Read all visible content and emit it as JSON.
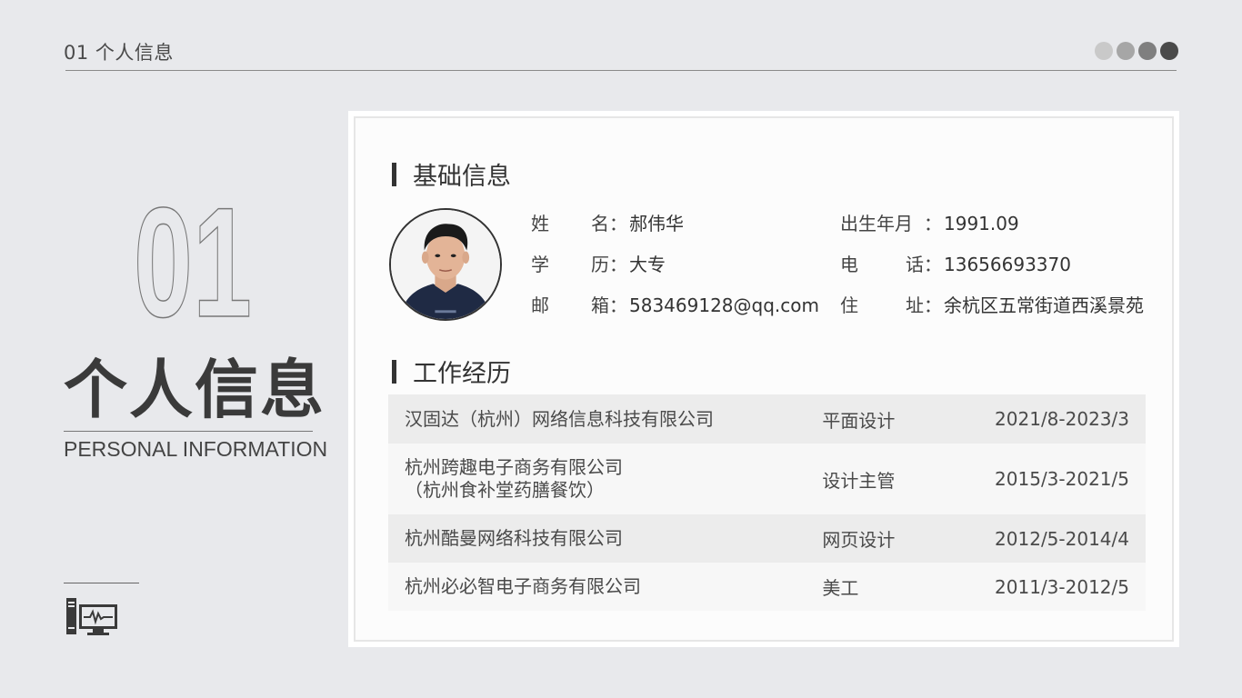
{
  "header": {
    "title": "01 个人信息",
    "dots": [
      "#c9c9c9",
      "#a6a6a6",
      "#7f7f7f",
      "#4a4a4a"
    ]
  },
  "left": {
    "number": "01",
    "title": "个人信息",
    "subtitle": "PERSONAL INFORMATION",
    "icon": "monitor-icon"
  },
  "basic": {
    "heading": "基础信息",
    "fields": [
      {
        "label": "姓名",
        "value": "郝伟华"
      },
      {
        "label": "出生年月",
        "value": "1991.09"
      },
      {
        "label": "学历",
        "value": "大专"
      },
      {
        "label": "电话",
        "value": "13656693370"
      },
      {
        "label": "邮箱",
        "value": "583469128@qq.com"
      },
      {
        "label": "住址",
        "value": "余杭区五常街道西溪景苑"
      }
    ]
  },
  "work": {
    "heading": "工作经历",
    "rows": [
      {
        "company": [
          "汉固达（杭州）网络信息科技有限公司"
        ],
        "role": "平面设计",
        "period": "2021/8-2023/3"
      },
      {
        "company": [
          "杭州跨趣电子商务有限公司",
          "（杭州食补堂药膳餐饮）"
        ],
        "role": "设计主管",
        "period": "2015/3-2021/5"
      },
      {
        "company": [
          "杭州酷曼网络科技有限公司"
        ],
        "role": "网页设计",
        "period": "2012/5-2014/4"
      },
      {
        "company": [
          "杭州必必智电子商务有限公司"
        ],
        "role": "美工",
        "period": "2011/3-2012/5"
      }
    ]
  }
}
